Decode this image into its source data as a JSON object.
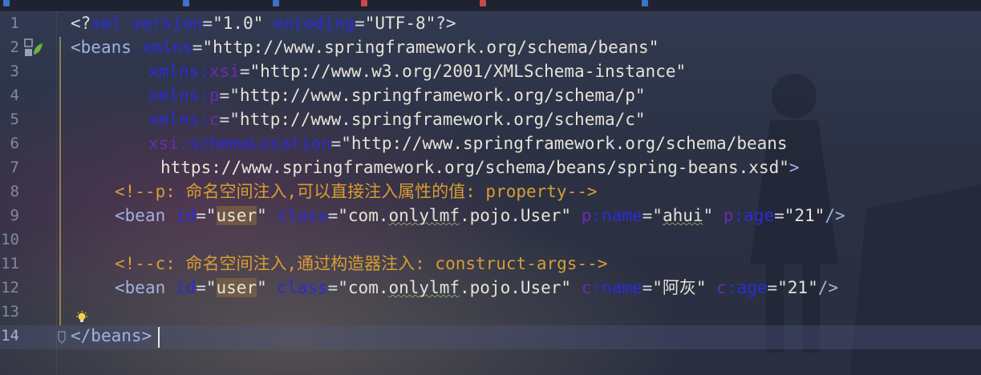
{
  "editor": {
    "file_type": "xml",
    "active_line": 14,
    "gutter_icons": [
      "spring-bean-icon",
      "lightbulb-icon",
      "fold-icon"
    ],
    "colors": {
      "background": "#2b3143",
      "comment": "#d79d34",
      "attribute": "#2b2bd8",
      "namespace_prefix": "#6a2bb0",
      "tag": "#9fb3e0"
    }
  },
  "line_numbers": [
    "1",
    "2",
    "3",
    "4",
    "5",
    "6",
    "7",
    "8",
    "9",
    "10",
    "11",
    "12",
    "13",
    "14"
  ],
  "lines": {
    "l1": {
      "open": "<?",
      "kw1": "xml",
      "kw2": "version",
      "eq1": "=",
      "v1": "\"1.0\"",
      "kw3": "encoding",
      "eq2": "=",
      "v2": "\"UTF-8\"",
      "close": "?>"
    },
    "l2": {
      "lt": "<",
      "tag": "beans",
      "attr": "xmlns",
      "eq": "=",
      "val": "\"http://www.springframework.org/schema/beans\""
    },
    "l3": {
      "attr": "xmlns",
      "colon": ":",
      "prefix": "xsi",
      "eq": "=",
      "val": "\"http://www.w3.org/2001/XMLSchema-instance\""
    },
    "l4": {
      "attr": "xmlns",
      "colon": ":",
      "prefix": "p",
      "eq": "=",
      "val": "\"http://www.springframework.org/schema/p\""
    },
    "l5": {
      "attr": "xmlns",
      "colon": ":",
      "prefix": "c",
      "eq": "=",
      "val": "\"http://www.springframework.org/schema/c\""
    },
    "l6": {
      "prefix": "xsi",
      "colon": ":",
      "attr": "schemaLocation",
      "eq": "=",
      "val": "\"http://www.springframework.org/schema/beans"
    },
    "l7": {
      "val": "https://www.springframework.org/schema/beans/spring-beans.xsd\"",
      "gt": ">"
    },
    "l8": {
      "comment": "<!--p: 命名空间注入,可以直接注入属性的值: property-->"
    },
    "l9": {
      "lt": "<",
      "tag": "bean",
      "a1": "id",
      "e1": "=",
      "q1": "\"",
      "v1": "user",
      "q2": "\"",
      "a2": "class",
      "e2": "=",
      "v2a": "\"com.",
      "v2b": "onlylmf",
      "v2c": ".pojo.User\"",
      "n3": "p",
      "c3": ":",
      "a3": "name",
      "e3": "=",
      "q3": "\"",
      "v3": "ahui",
      "q4": "\"",
      "n4": "p",
      "c4": ":",
      "a4": "age",
      "e4": "=",
      "v4": "\"21\"",
      "end": "/>"
    },
    "l10": {
      "text": ""
    },
    "l11": {
      "comment": "<!--c: 命名空间注入,通过构造器注入: construct-args-->"
    },
    "l12": {
      "lt": "<",
      "tag": "bean",
      "a1": "id",
      "e1": "=",
      "q1": "\"",
      "v1": "user",
      "q2": "\"",
      "a2": "class",
      "e2": "=",
      "v2a": "\"com.",
      "v2b": "onlylmf",
      "v2c": ".pojo.User\"",
      "n3": "c",
      "c3": ":",
      "a3": "name",
      "e3": "=",
      "v3": "\"阿灰\"",
      "n4": "c",
      "c4": ":",
      "a4": "age",
      "e4": "=",
      "v4": "\"21\"",
      "end": "/>"
    },
    "l13": {
      "text": ""
    },
    "l14": {
      "lt": "</",
      "tag": "beans",
      "gt": ">"
    }
  }
}
